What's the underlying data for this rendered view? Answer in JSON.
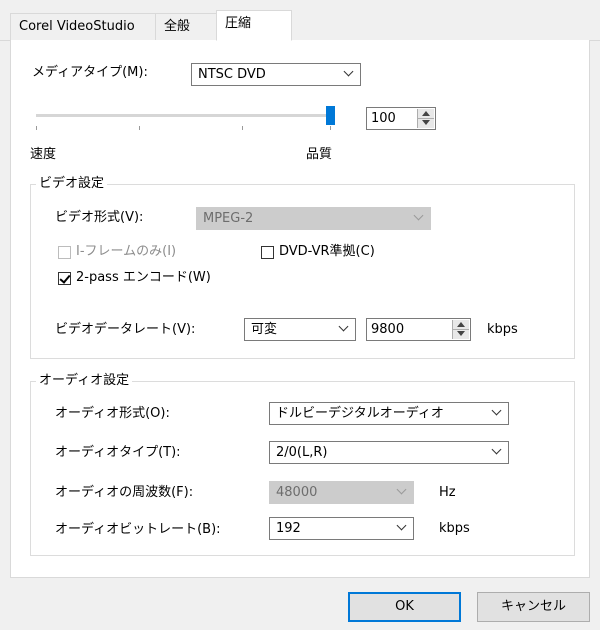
{
  "tabs": [
    {
      "label": "Corel VideoStudio",
      "active": false
    },
    {
      "label": "全般",
      "active": false
    },
    {
      "label": "圧縮",
      "active": true
    }
  ],
  "media_type": {
    "label": "メディアタイプ(M):",
    "value": "NTSC DVD"
  },
  "quality_slider": {
    "value": 100,
    "min_label": "速度",
    "max_label": "品質",
    "spin_value": "100"
  },
  "video": {
    "group_title": "ビデオ設定",
    "format_label": "ビデオ形式(V):",
    "format_value": "MPEG-2",
    "iframe_label": "I-フレームのみ(I)",
    "dvdvr_label": "DVD-VR準拠(C)",
    "twopass_label": "2-pass エンコード(W)",
    "datarate_label": "ビデオデータレート(V):",
    "datarate_mode": "可変",
    "datarate_value": "9800",
    "datarate_unit": "kbps",
    "checks": {
      "iframe": false,
      "dvdvr": false,
      "twopass": true
    }
  },
  "audio": {
    "group_title": "オーディオ設定",
    "format_label": "オーディオ形式(O):",
    "format_value": "ドルビーデジタルオーディオ",
    "type_label": "オーディオタイプ(T):",
    "type_value": "2/0(L,R)",
    "freq_label": "オーディオの周波数(F):",
    "freq_value": "48000",
    "freq_unit": "Hz",
    "bitrate_label": "オーディオビットレート(B):",
    "bitrate_value": "192",
    "bitrate_unit": "kbps"
  },
  "buttons": {
    "ok": "OK",
    "cancel": "キャンセル"
  },
  "colors": {
    "accent": "#0078d7",
    "dialog_bg": "#f0f0f0",
    "panel_bg": "#ffffff"
  }
}
